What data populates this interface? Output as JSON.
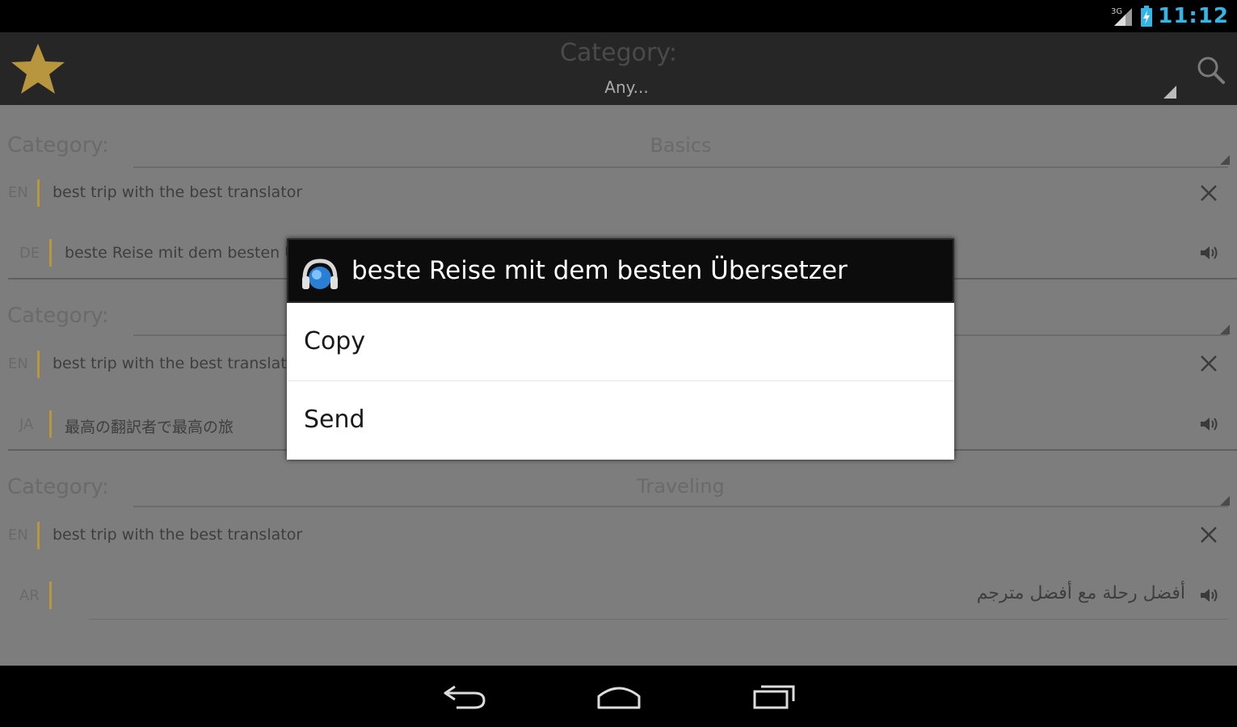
{
  "status_bar": {
    "clock": "11:12",
    "network_label": "3G",
    "icons": [
      "signal-icon",
      "battery-icon"
    ]
  },
  "action_bar": {
    "title": "Category:",
    "value": "Any...",
    "icons": [
      "star-icon",
      "search-icon"
    ]
  },
  "cards": [
    {
      "category_label": "Category:",
      "category_value": "Basics",
      "rows": [
        {
          "lang": "EN",
          "text": "best trip with the best translator",
          "action": "close-icon"
        },
        {
          "lang": "DE",
          "text": "beste Reise mit dem besten Ü",
          "action": "speaker-icon"
        }
      ]
    },
    {
      "category_label": "Category:",
      "category_value": "",
      "rows": [
        {
          "lang": "EN",
          "text": "best trip with the best translato",
          "action": "close-icon"
        },
        {
          "lang": "JA",
          "text": "最高の翻訳者で最高の旅",
          "action": "speaker-icon"
        }
      ]
    },
    {
      "category_label": "Category:",
      "category_value": "Traveling",
      "rows": [
        {
          "lang": "EN",
          "text": "best trip with the best translator",
          "action": "close-icon"
        },
        {
          "lang": "AR",
          "text": "أفضل رحلة مع أفضل مترجم",
          "action": "speaker-icon"
        }
      ]
    }
  ],
  "dialog": {
    "title": "beste Reise mit dem besten Übersetzer",
    "icon": "headphones-globe-icon",
    "items": [
      "Copy",
      "Send"
    ]
  },
  "nav_bar": {
    "icons": [
      "back-icon",
      "home-icon",
      "recents-icon"
    ]
  },
  "colors": {
    "accent_blue": "#33b5e5",
    "star_gold": "#b8963e",
    "content_bg": "#7d7d7d",
    "action_bar_bg": "#262626"
  }
}
